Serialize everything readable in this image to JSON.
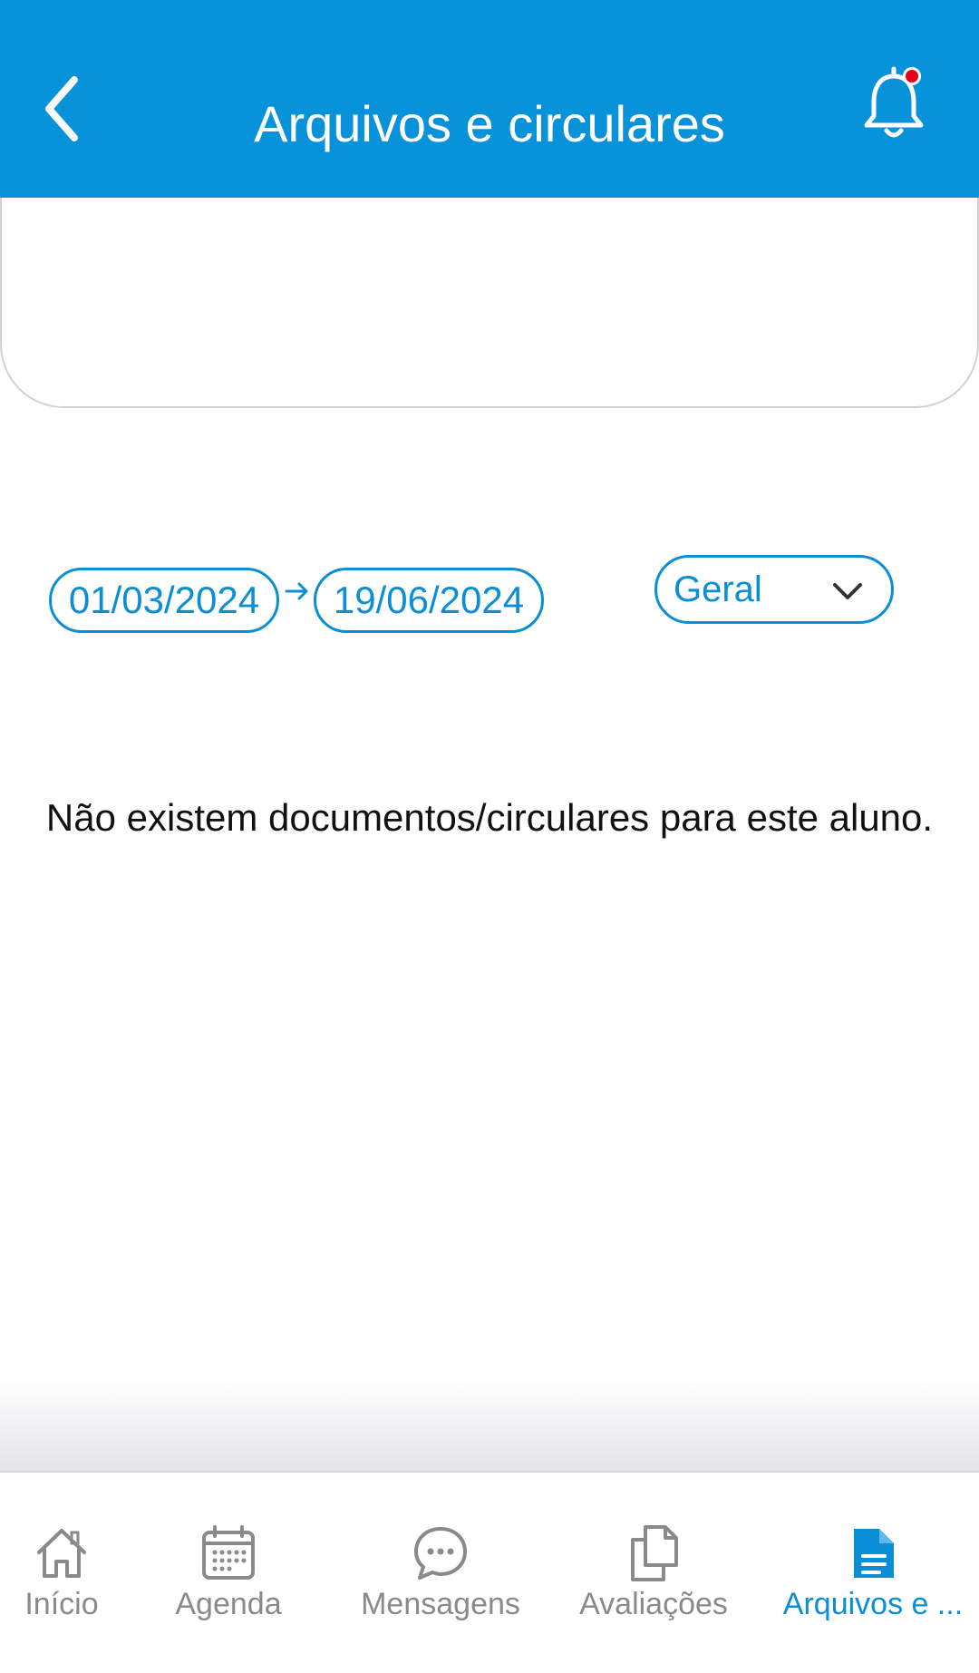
{
  "header": {
    "title": "Arquivos e circulares",
    "accent_color": "#0892d9",
    "back_icon": "chevron-left-icon",
    "notification_icon": "bell-icon",
    "notification_badge_color": "#e6001a"
  },
  "filters": {
    "date_from": "01/03/2024",
    "date_to": "19/06/2024",
    "category_selected": "Geral"
  },
  "content": {
    "empty_message": "Não existem documentos/circulares para este aluno."
  },
  "bottom_nav": {
    "active_color": "#0a8fd6",
    "inactive_color": "#8a8a8a",
    "items": [
      {
        "label": "Início",
        "icon": "home-icon"
      },
      {
        "label": "Agenda",
        "icon": "calendar-icon"
      },
      {
        "label": "Mensagens",
        "icon": "chat-icon"
      },
      {
        "label": "Avaliações",
        "icon": "documents-icon"
      },
      {
        "label": "Arquivos e ...",
        "icon": "file-icon",
        "active": true
      }
    ]
  }
}
